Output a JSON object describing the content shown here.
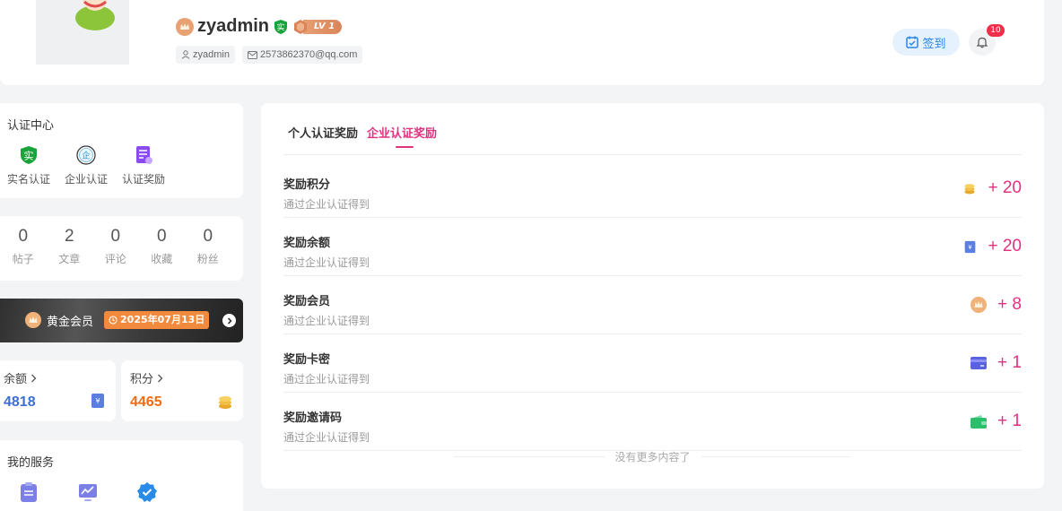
{
  "header": {
    "username": "zyadmin",
    "verified_badge": "实",
    "level": "LV 1",
    "login_name": "zyadmin",
    "email": "2573862370@qq.com",
    "checkin_label": "签到",
    "notification_count": "10"
  },
  "verify": {
    "title": "认证中心",
    "items": [
      {
        "label": "实名认证",
        "icon": "real-name-icon",
        "glyph": "实"
      },
      {
        "label": "企业认证",
        "icon": "enterprise-icon",
        "glyph": "企"
      },
      {
        "label": "认证奖励",
        "icon": "reward-doc-icon"
      }
    ]
  },
  "stats": [
    {
      "value": "0",
      "label": "帖子"
    },
    {
      "value": "2",
      "label": "文章"
    },
    {
      "value": "0",
      "label": "评论"
    },
    {
      "value": "0",
      "label": "收藏"
    },
    {
      "value": "0",
      "label": "粉丝"
    }
  ],
  "vip": {
    "label": "黄金会员",
    "expiry": "2025年07月13日"
  },
  "balance": {
    "label": "余额",
    "value": "4818",
    "color": "#3d6fd6"
  },
  "points": {
    "label": "积分",
    "value": "4465",
    "color": "#f26b10"
  },
  "services": {
    "title": "我的服务"
  },
  "tabs": [
    {
      "label": "个人认证奖励",
      "active": false
    },
    {
      "label": "企业认证奖励",
      "active": true
    }
  ],
  "rewards": [
    {
      "title": "奖励积分",
      "desc": "通过企业认证得到",
      "value": "+ 20",
      "icon": "coins-icon"
    },
    {
      "title": "奖励余额",
      "desc": "通过企业认证得到",
      "value": "+ 20",
      "icon": "yuan-icon"
    },
    {
      "title": "奖励会员",
      "desc": "通过企业认证得到",
      "value": "+ 8",
      "icon": "crown-icon"
    },
    {
      "title": "奖励卡密",
      "desc": "通过企业认证得到",
      "value": "+ 1",
      "icon": "card-icon"
    },
    {
      "title": "奖励邀请码",
      "desc": "通过企业认证得到",
      "value": "+ 1",
      "icon": "wallet-icon"
    }
  ],
  "footer_text": "没有更多内容了",
  "accent_color": "#e0327f"
}
